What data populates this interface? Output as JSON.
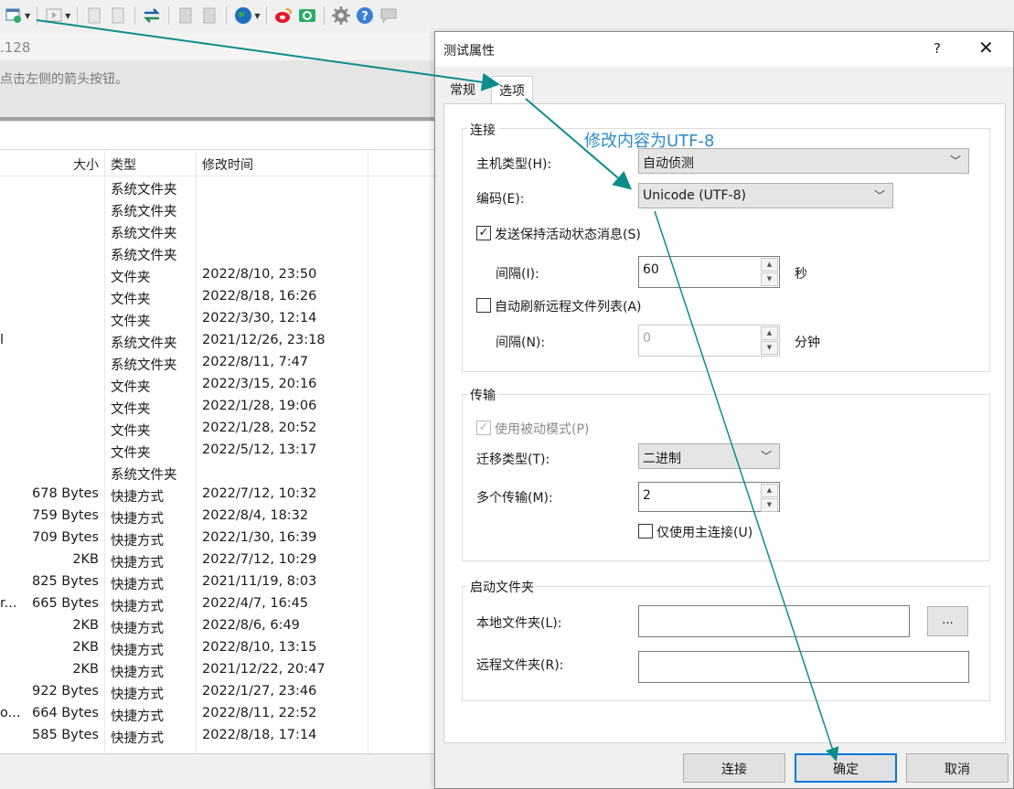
{
  "toolbar": {
    "icons": [
      "new-session-icon",
      "dropdown-caret-icon",
      "play-icon",
      "dropdown-caret-icon",
      "copy-icon",
      "paste-icon",
      "transfer-icon",
      "doc-icon",
      "doc2-icon",
      "globe-icon",
      "dropdown-caret-icon",
      "weibo-icon",
      "wechat-icon",
      "gear-icon",
      "help-icon",
      "chat-icon"
    ]
  },
  "address_text": ".128",
  "message_text": "点击左侧的箭头按钮。",
  "file_list": {
    "headers": {
      "size": "大小",
      "type": "类型",
      "modified": "修改时间"
    },
    "rows": [
      {
        "name": "",
        "size": "",
        "type": "系统文件夹",
        "modified": ""
      },
      {
        "name": "",
        "size": "",
        "type": "系统文件夹",
        "modified": ""
      },
      {
        "name": "",
        "size": "",
        "type": "系统文件夹",
        "modified": ""
      },
      {
        "name": "",
        "size": "",
        "type": "系统文件夹",
        "modified": ""
      },
      {
        "name": "",
        "size": "",
        "type": "文件夹",
        "modified": "2022/8/10, 23:50"
      },
      {
        "name": "",
        "size": "",
        "type": "文件夹",
        "modified": "2022/8/18, 16:26"
      },
      {
        "name": "",
        "size": "",
        "type": "文件夹",
        "modified": "2022/3/30, 12:14"
      },
      {
        "name": "l",
        "size": "",
        "type": "系统文件夹",
        "modified": "2021/12/26, 23:18"
      },
      {
        "name": "",
        "size": "",
        "type": "系统文件夹",
        "modified": "2022/8/11, 7:47"
      },
      {
        "name": "",
        "size": "",
        "type": "文件夹",
        "modified": "2022/3/15, 20:16"
      },
      {
        "name": "",
        "size": "",
        "type": "文件夹",
        "modified": "2022/1/28, 19:06"
      },
      {
        "name": "",
        "size": "",
        "type": "文件夹",
        "modified": "2022/1/28, 20:52"
      },
      {
        "name": "",
        "size": "",
        "type": "文件夹",
        "modified": "2022/5/12, 13:17"
      },
      {
        "name": "",
        "size": "",
        "type": "系统文件夹",
        "modified": ""
      },
      {
        "name": "",
        "size": "678 Bytes",
        "type": "快捷方式",
        "modified": "2022/7/12, 10:32"
      },
      {
        "name": "",
        "size": "759 Bytes",
        "type": "快捷方式",
        "modified": "2022/8/4, 18:32"
      },
      {
        "name": "",
        "size": "709 Bytes",
        "type": "快捷方式",
        "modified": "2022/1/30, 16:39"
      },
      {
        "name": "",
        "size": "2KB",
        "type": "快捷方式",
        "modified": "2022/7/12, 10:29"
      },
      {
        "name": "",
        "size": "825 Bytes",
        "type": "快捷方式",
        "modified": "2021/11/19, 8:03"
      },
      {
        "name": "r...",
        "size": "665 Bytes",
        "type": "快捷方式",
        "modified": "2022/4/7, 16:45"
      },
      {
        "name": "",
        "size": "2KB",
        "type": "快捷方式",
        "modified": "2022/8/6, 6:49"
      },
      {
        "name": "",
        "size": "2KB",
        "type": "快捷方式",
        "modified": "2022/8/10, 13:15"
      },
      {
        "name": "",
        "size": "2KB",
        "type": "快捷方式",
        "modified": "2021/12/22, 20:47"
      },
      {
        "name": "",
        "size": "922 Bytes",
        "type": "快捷方式",
        "modified": "2022/1/27, 23:46"
      },
      {
        "name": "o...",
        "size": "664 Bytes",
        "type": "快捷方式",
        "modified": "2022/8/11, 22:52"
      },
      {
        "name": "",
        "size": "585 Bytes",
        "type": "快捷方式",
        "modified": "2022/8/18, 17:14"
      }
    ]
  },
  "dialog": {
    "title": "测试属性",
    "help_label": "?",
    "close_label": "✕",
    "tabs": [
      {
        "label": "常规",
        "active": false
      },
      {
        "label": "选项",
        "active": true
      }
    ],
    "connection": {
      "group_label": "连接",
      "host_type_label": "主机类型(H):",
      "host_type_value": "自动侦测",
      "encoding_label": "编码(E):",
      "encoding_value": "Unicode (UTF-8)",
      "keepalive_label": "发送保持活动状态消息(S)",
      "keepalive_checked": true,
      "interval_label": "间隔(I):",
      "interval_value": "60",
      "interval_unit": "秒",
      "autorefresh_label": "自动刷新远程文件列表(A)",
      "autorefresh_checked": false,
      "refresh_interval_label": "间隔(N):",
      "refresh_interval_value": "0",
      "refresh_interval_unit": "分钟"
    },
    "transfer": {
      "group_label": "传输",
      "passive_label": "使用被动模式(P)",
      "passive_checked": true,
      "transfer_type_label": "迁移类型(T):",
      "transfer_type_value": "二进制",
      "multi_label": "多个传输(M):",
      "multi_value": "2",
      "main_only_label": "仅使用主连接(U)",
      "main_only_checked": false
    },
    "startup": {
      "group_label": "启动文件夹",
      "local_label": "本地文件夹(L):",
      "local_value": "",
      "browse_label": "...",
      "remote_label": "远程文件夹(R):",
      "remote_value": ""
    },
    "buttons": {
      "connect": "连接",
      "ok": "确定",
      "cancel": "取消"
    }
  },
  "annotation": {
    "text": "修改内容为UTF-8",
    "color": "#2e8bc9",
    "arrow_color": "#0e8c8c"
  },
  "colors": {
    "accent": "#0078d7",
    "globe": "#1f6fbf",
    "weibo": "#e6162d",
    "wechat": "#2aae67",
    "help": "#3b7fd8"
  }
}
